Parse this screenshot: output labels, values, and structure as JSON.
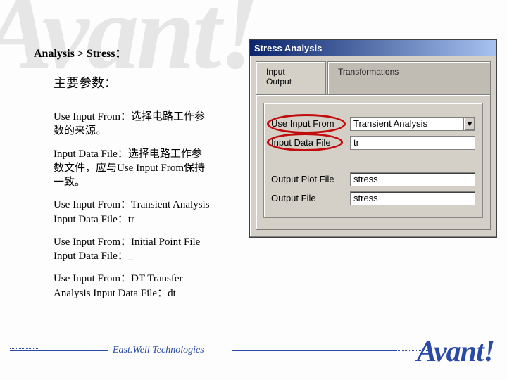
{
  "breadcrumb": "Analysis > Stress：",
  "subtitle": "主要参数：",
  "paragraphs": {
    "p1a": "Use Input From：选择电路工作参",
    "p1b": "数的来源。",
    "p2a": "Input Data File：选择电路工作参",
    "p2b": "数文件，应与Use Input From保持",
    "p2c": "一致。",
    "p3a": "Use Input From：Transient Analysis",
    "p3b": "Input Data File：tr",
    "p4a": "Use Input From：Initial Point File",
    "p4b": "Input Data File：_",
    "p5a": "Use Input From：DT Transfer",
    "p5b": "Analysis  Input Data File：dt"
  },
  "dialog": {
    "title": "Stress Analysis",
    "tabs": {
      "t1l1": "Input",
      "t1l2": "Output",
      "t2": "Transformations"
    },
    "rows": {
      "use_input_from": {
        "label": "Use Input From",
        "value": "Transient Analysis"
      },
      "input_data_file": {
        "label": "Input Data File",
        "value": "tr"
      },
      "output_plot_file": {
        "label": "Output Plot File",
        "value": "stress"
      },
      "output_file": {
        "label": "Output File",
        "value": "stress"
      }
    }
  },
  "footer": {
    "company": "East.Well Technologies",
    "logo": "Avant!"
  }
}
